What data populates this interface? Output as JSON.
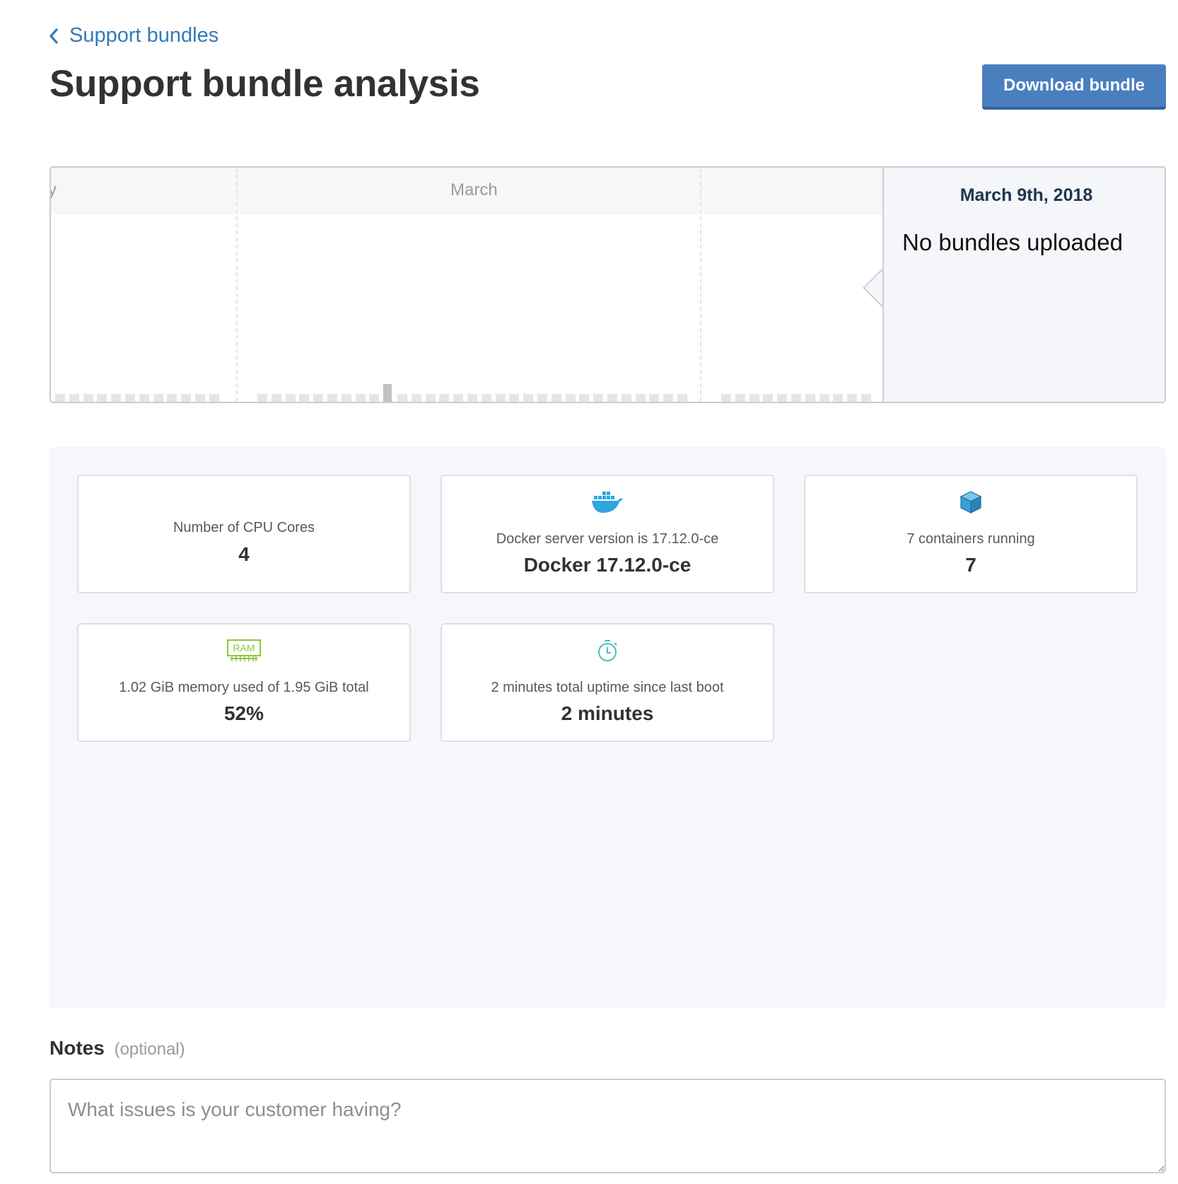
{
  "breadcrumb": {
    "back_label": "Support bundles"
  },
  "header": {
    "title": "Support bundle analysis",
    "download_label": "Download bundle"
  },
  "timeline": {
    "months": [
      {
        "label": "y"
      },
      {
        "label": "March"
      }
    ],
    "detail": {
      "date": "March 9th, 2018",
      "message": "No bundles uploaded"
    }
  },
  "metrics": [
    {
      "label": "Number of CPU Cores",
      "value": "4",
      "icon": "none"
    },
    {
      "label": "Docker server version is 17.12.0-ce",
      "value": "Docker 17.12.0-ce",
      "icon": "docker-icon"
    },
    {
      "label": "7 containers running",
      "value": "7",
      "icon": "cube-icon"
    },
    {
      "label": "1.02 GiB memory used of 1.95 GiB total",
      "value": "52%",
      "icon": "ram-icon",
      "icon_text": "RAM"
    },
    {
      "label": "2 minutes total uptime since last boot",
      "value": "2 minutes",
      "icon": "stopwatch-icon"
    }
  ],
  "notes": {
    "title": "Notes",
    "optional": "(optional)",
    "placeholder": "What issues is your customer having?"
  },
  "colors": {
    "link": "#337ab7",
    "primary_button": "#4a7fbf",
    "docker_blue": "#2fa6e0",
    "cube_blue": "#3a9fd6",
    "ram_green": "#8cc63f",
    "stopwatch_teal": "#4dbdbd"
  }
}
